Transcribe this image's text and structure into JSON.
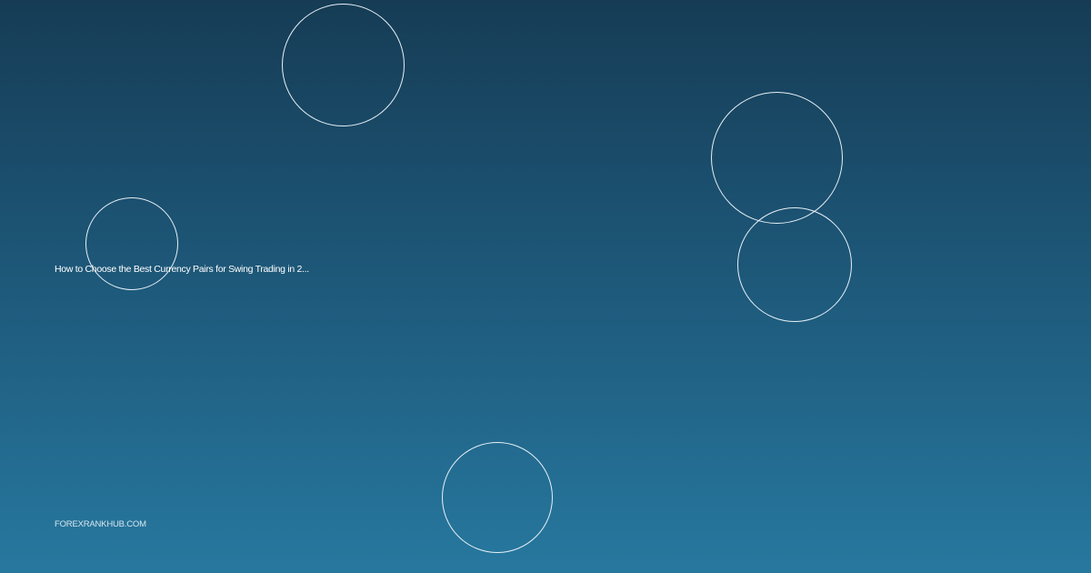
{
  "card": {
    "headline": "How to Choose the Best Currency Pairs for Swing Trading in 2...",
    "site": "FOREXRANKHUB.COM"
  },
  "colors": {
    "gradient_top": "#163c55",
    "gradient_bottom": "#27789f",
    "ring": "#e6f0f6",
    "text": "#ffffff"
  },
  "decorations": {
    "rings": [
      "circle-outline",
      "circle-outline",
      "circle-outline",
      "circle-outline",
      "circle-outline"
    ]
  }
}
